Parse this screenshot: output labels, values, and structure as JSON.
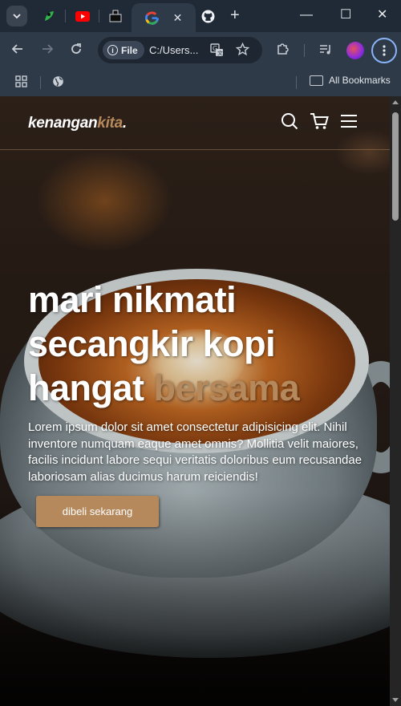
{
  "browser": {
    "tabs": [
      {
        "icon": "feather-app-icon"
      },
      {
        "icon": "youtube-icon"
      },
      {
        "icon": "dark-site-icon"
      },
      {
        "icon": "google-icon",
        "active": true
      },
      {
        "icon": "github-icon"
      }
    ],
    "new_tab_label": "+",
    "close_tab_label": "✕",
    "window": {
      "minimize": "—",
      "maximize": "☐",
      "close": "✕"
    },
    "address": {
      "chip_label": "File",
      "url": "C:/Users..."
    },
    "bookmarks": {
      "all_label": "All Bookmarks"
    }
  },
  "site": {
    "logo_main": "kenangan",
    "logo_accent": "kita",
    "logo_dot": ".",
    "hero": {
      "title_main": "mari nikmati secangkir kopi hangat",
      "title_accent": "bersama",
      "text": "Lorem ipsum dolor sit amet consectetur adipisicing elit. Nihil inventore numquam eaque amet omnis? Mollitia velit maiores, facilis incidunt labore sequi veritatis doloribus eum recusandae laboriosam alias ducimus harum reiciendis!",
      "cta_label": "dibeli sekarang"
    }
  },
  "colors": {
    "accent": "#b6895d",
    "chrome_dark": "#202a36",
    "chrome": "#2e3a48"
  }
}
